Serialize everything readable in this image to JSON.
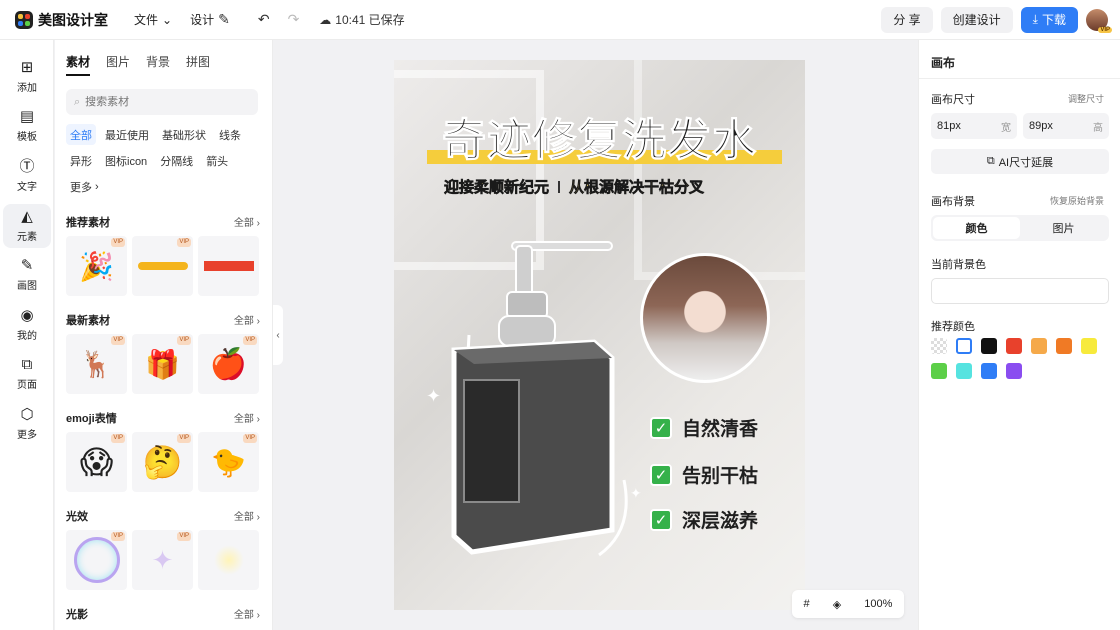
{
  "app": {
    "name": "美图设计室"
  },
  "topbar": {
    "file_label": "文件",
    "design_label": "设计",
    "save_status": "10:41 已保存",
    "share_label": "分 享",
    "create_label": "创建设计",
    "download_label": "下载",
    "vip_badge": "VIP"
  },
  "rail": {
    "items": [
      {
        "label": "添加",
        "icon": "plus-square-icon"
      },
      {
        "label": "模板",
        "icon": "template-icon"
      },
      {
        "label": "文字",
        "icon": "text-icon"
      },
      {
        "label": "元素",
        "icon": "element-icon"
      },
      {
        "label": "画图",
        "icon": "draw-icon"
      },
      {
        "label": "我的",
        "icon": "user-icon"
      },
      {
        "label": "页面",
        "icon": "page-icon"
      },
      {
        "label": "更多",
        "icon": "cube-icon"
      }
    ],
    "active_index": 3
  },
  "panel": {
    "tabs": [
      "素材",
      "图片",
      "背景",
      "拼图"
    ],
    "search_placeholder": "搜索素材",
    "chips": [
      "全部",
      "最近使用",
      "基础形状",
      "线条",
      "异形",
      "图标icon",
      "分隔线",
      "箭头",
      "更多"
    ],
    "all_label": "全部",
    "vip": "VIP",
    "sections": [
      {
        "title": "推荐素材"
      },
      {
        "title": "最新素材"
      },
      {
        "title": "emoji表情"
      },
      {
        "title": "光效"
      },
      {
        "title": "光影"
      }
    ]
  },
  "poster": {
    "title": "奇迹修复洗发水",
    "subtitle_left": "迎接柔顺新纪元",
    "subtitle_right": "从根源解决干枯分叉",
    "features": [
      "自然清香",
      "告别干枯",
      "深层滋养"
    ],
    "accent_color": "#f5cd3c",
    "check_color": "#35b14a"
  },
  "canvas_tools": {
    "zoom": "100%"
  },
  "right_panel": {
    "title": "画布",
    "size_label": "画布尺寸",
    "adjust_label": "调整尺寸",
    "width_value": "81px",
    "width_unit": "宽",
    "height_value": "89px",
    "height_unit": "高",
    "ai_extend_label": "AI尺寸延展",
    "bg_label": "画布背景",
    "restore_label": "恢复原始背景",
    "seg_color": "颜色",
    "seg_image": "图片",
    "current_bg_label": "当前背景色",
    "recommended_label": "推荐颜色",
    "swatches": [
      "transparent",
      "#ffffff",
      "#111111",
      "#e8412c",
      "#f5a94a",
      "#f07a25",
      "#f7ea3c",
      "#5ccf48",
      "#56e3e0",
      "#2f7df6",
      "#8a4df0"
    ]
  }
}
